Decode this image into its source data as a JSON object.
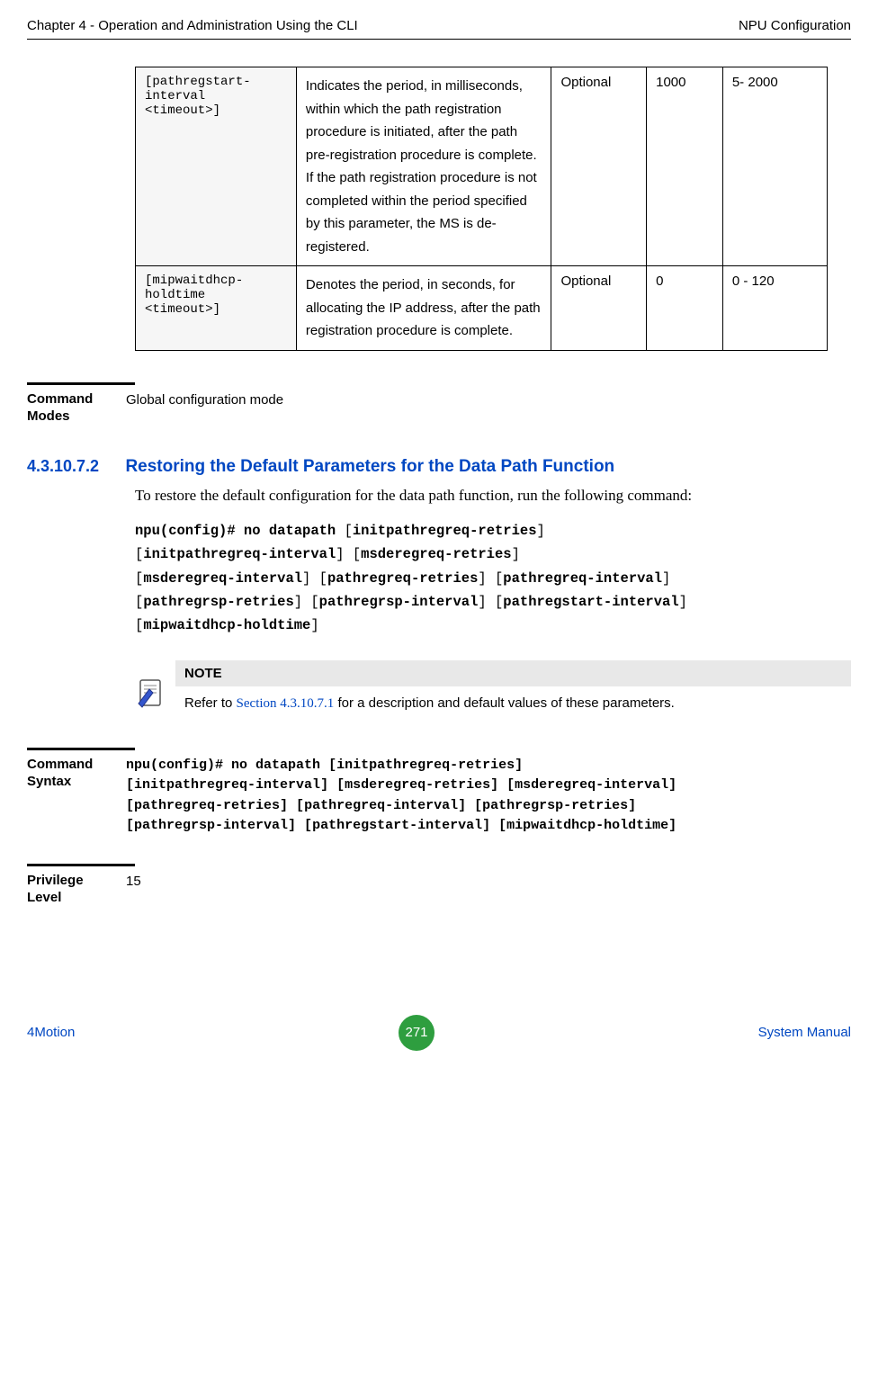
{
  "header": {
    "left": "Chapter 4 - Operation and Administration Using the CLI",
    "right": "NPU Configuration"
  },
  "table": {
    "rows": [
      {
        "param": "[pathregstart-interval <timeout>]",
        "desc": "Indicates the period, in milliseconds, within which the path registration procedure is initiated, after the path pre-registration procedure is complete. If the path registration procedure is not completed within the period specified by this parameter, the MS is de-registered.",
        "presence": "Optional",
        "default": "1000",
        "range": "5- 2000"
      },
      {
        "param": "[mipwaitdhcp-holdtime <timeout>]",
        "desc": "Denotes the period, in seconds, for allocating the IP address, after the path registration procedure is complete.",
        "presence": "Optional",
        "default": "0",
        "range": "0 - 120"
      }
    ]
  },
  "command_modes": {
    "label": "Command Modes",
    "value": "Global configuration mode"
  },
  "section": {
    "number": "4.3.10.7.2",
    "title": "Restoring the Default Parameters for the Data Path Function",
    "body": "To restore the default configuration for the data path function, run the following command:"
  },
  "cmd": {
    "prefix": "npu(config)# no datapath",
    "p1": "initpathregreq-retries",
    "p2": "initpathregreq-interval",
    "p3": "msderegreq-retries",
    "p4": "msderegreq-interval",
    "p5": "pathregreq-retries",
    "p6": "pathregreq-interval",
    "p7": "pathregrsp-retries",
    "p8": "pathregrsp-interval",
    "p9": "pathregstart-interval",
    "p10": "mipwaitdhcp-holdtime"
  },
  "note": {
    "header": "NOTE",
    "pre": "Refer to ",
    "link": "Section 4.3.10.7.1",
    "post": " for a description and default values of these parameters."
  },
  "command_syntax_label": "Command Syntax",
  "privilege": {
    "label": "Privilege Level",
    "value": "15"
  },
  "footer": {
    "left": "4Motion",
    "page": "271",
    "right": "System Manual"
  }
}
